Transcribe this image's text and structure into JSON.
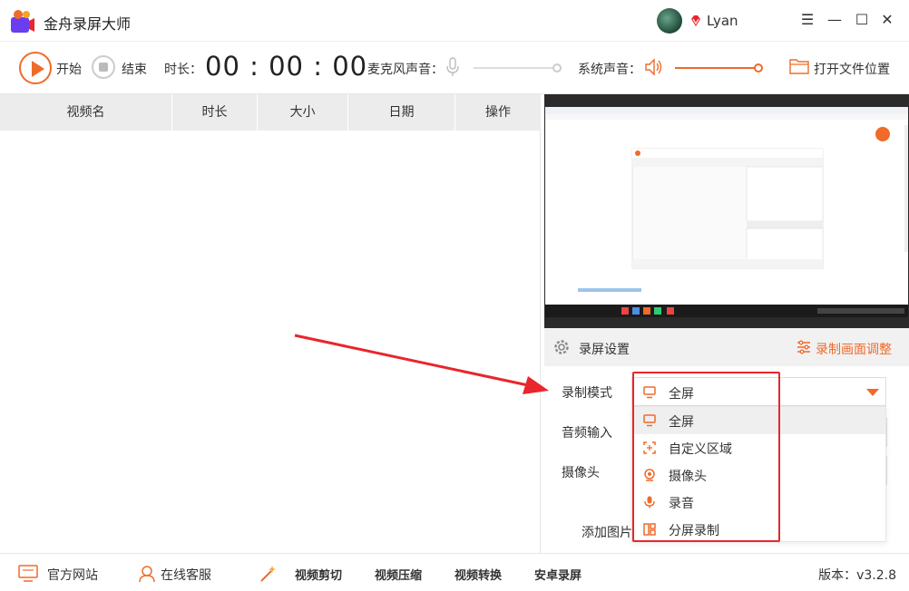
{
  "app": {
    "title": "金舟录屏大师",
    "username": "Lyan",
    "accent_color": "#f06a2a"
  },
  "window_controls": {
    "menu": "☰",
    "minimize": "—",
    "maximize": "☐",
    "close": "✕"
  },
  "toolbar": {
    "start_label": "开始",
    "stop_label": "结束",
    "duration_label": "时长：",
    "duration_value": "00 : 00 : 00",
    "mic_label": "麦克风声音：",
    "mic_volume": 1.0,
    "system_label": "系统声音：",
    "system_volume": 1.0,
    "open_folder_label": "打开文件位置"
  },
  "table": {
    "columns": [
      "视频名",
      "时长",
      "大小",
      "日期",
      "操作"
    ],
    "rows": []
  },
  "settings": {
    "title": "录屏设置",
    "adjust_label": "录制画面调整",
    "mode_label": "录制模式",
    "mode_selected": "全屏",
    "audio_label": "音频输入",
    "camera_label": "摄像头",
    "add_image_label": "添加图片",
    "mode_options": [
      {
        "label": "全屏",
        "icon": "monitor-icon"
      },
      {
        "label": "自定义区域",
        "icon": "region-icon"
      },
      {
        "label": "摄像头",
        "icon": "webcam-icon"
      },
      {
        "label": "录音",
        "icon": "microphone-icon"
      },
      {
        "label": "分屏录制",
        "icon": "split-screen-icon"
      }
    ]
  },
  "footer": {
    "website_label": "官方网站",
    "service_label": "在线客服",
    "video_cut": "视频剪切",
    "video_compress": "视频压缩",
    "video_convert": "视频转换",
    "android_record": "安卓录屏",
    "version": "版本：v3.2.8"
  }
}
